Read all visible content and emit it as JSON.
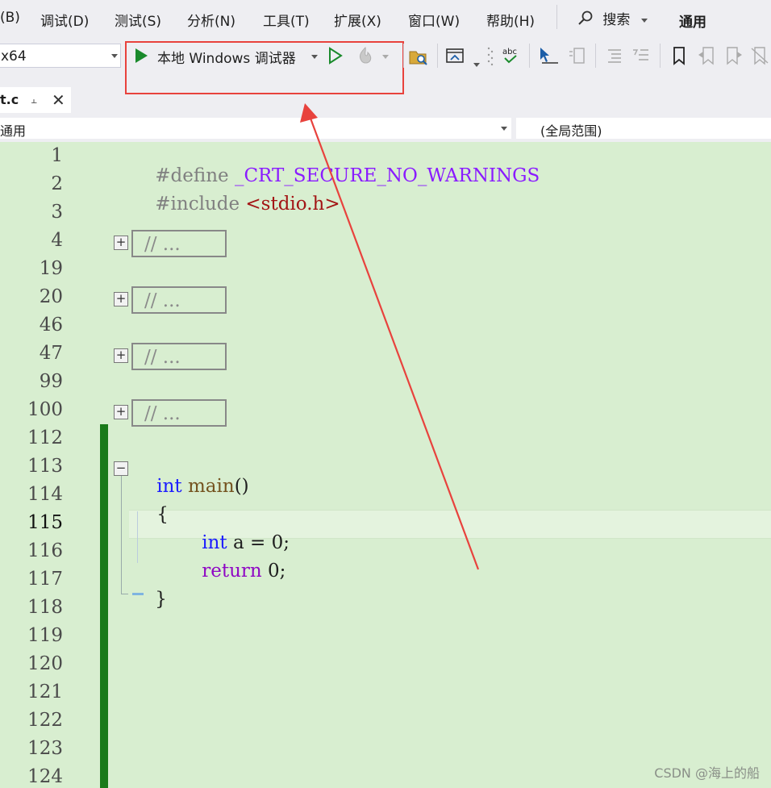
{
  "menu": {
    "items": [
      "(B)",
      "调试(D)",
      "测试(S)",
      "分析(N)",
      "工具(T)",
      "扩展(X)",
      "窗口(W)",
      "帮助(H)"
    ],
    "search_label": "搜索",
    "config": "通用"
  },
  "toolbar": {
    "platform": "x64",
    "run_label": "本地 Windows 调试器"
  },
  "tab": {
    "filename": "t.c"
  },
  "navbar": {
    "project": "通用",
    "scope": "(全局范围)"
  },
  "editor": {
    "line_numbers": [
      "1",
      "2",
      "3",
      "4",
      "19",
      "20",
      "46",
      "47",
      "99",
      "100",
      "112",
      "113",
      "114",
      "115",
      "116",
      "117",
      "118",
      "119",
      "120",
      "121",
      "122",
      "123",
      "124"
    ],
    "current_line": "115",
    "define_kw": "#define",
    "define_macro": "_CRT_SECURE_NO_WARNINGS",
    "include_kw": "#include",
    "include_file": "<stdio.h>",
    "collapsed_text": "// ...",
    "main_type": "int",
    "main_name": "main",
    "main_parens": "()",
    "open_brace": "{",
    "var_type": "int",
    "var_decl": " a = 0;",
    "return_kw": "return",
    "return_val": " 0;",
    "close_brace": "}"
  },
  "watermark": "CSDN @海上的船",
  "colors": {
    "editor_bg": "#d8eed0",
    "change_bar": "#1a7a1a",
    "highlight": "#e8423d",
    "run_green": "#1a8a2c"
  }
}
